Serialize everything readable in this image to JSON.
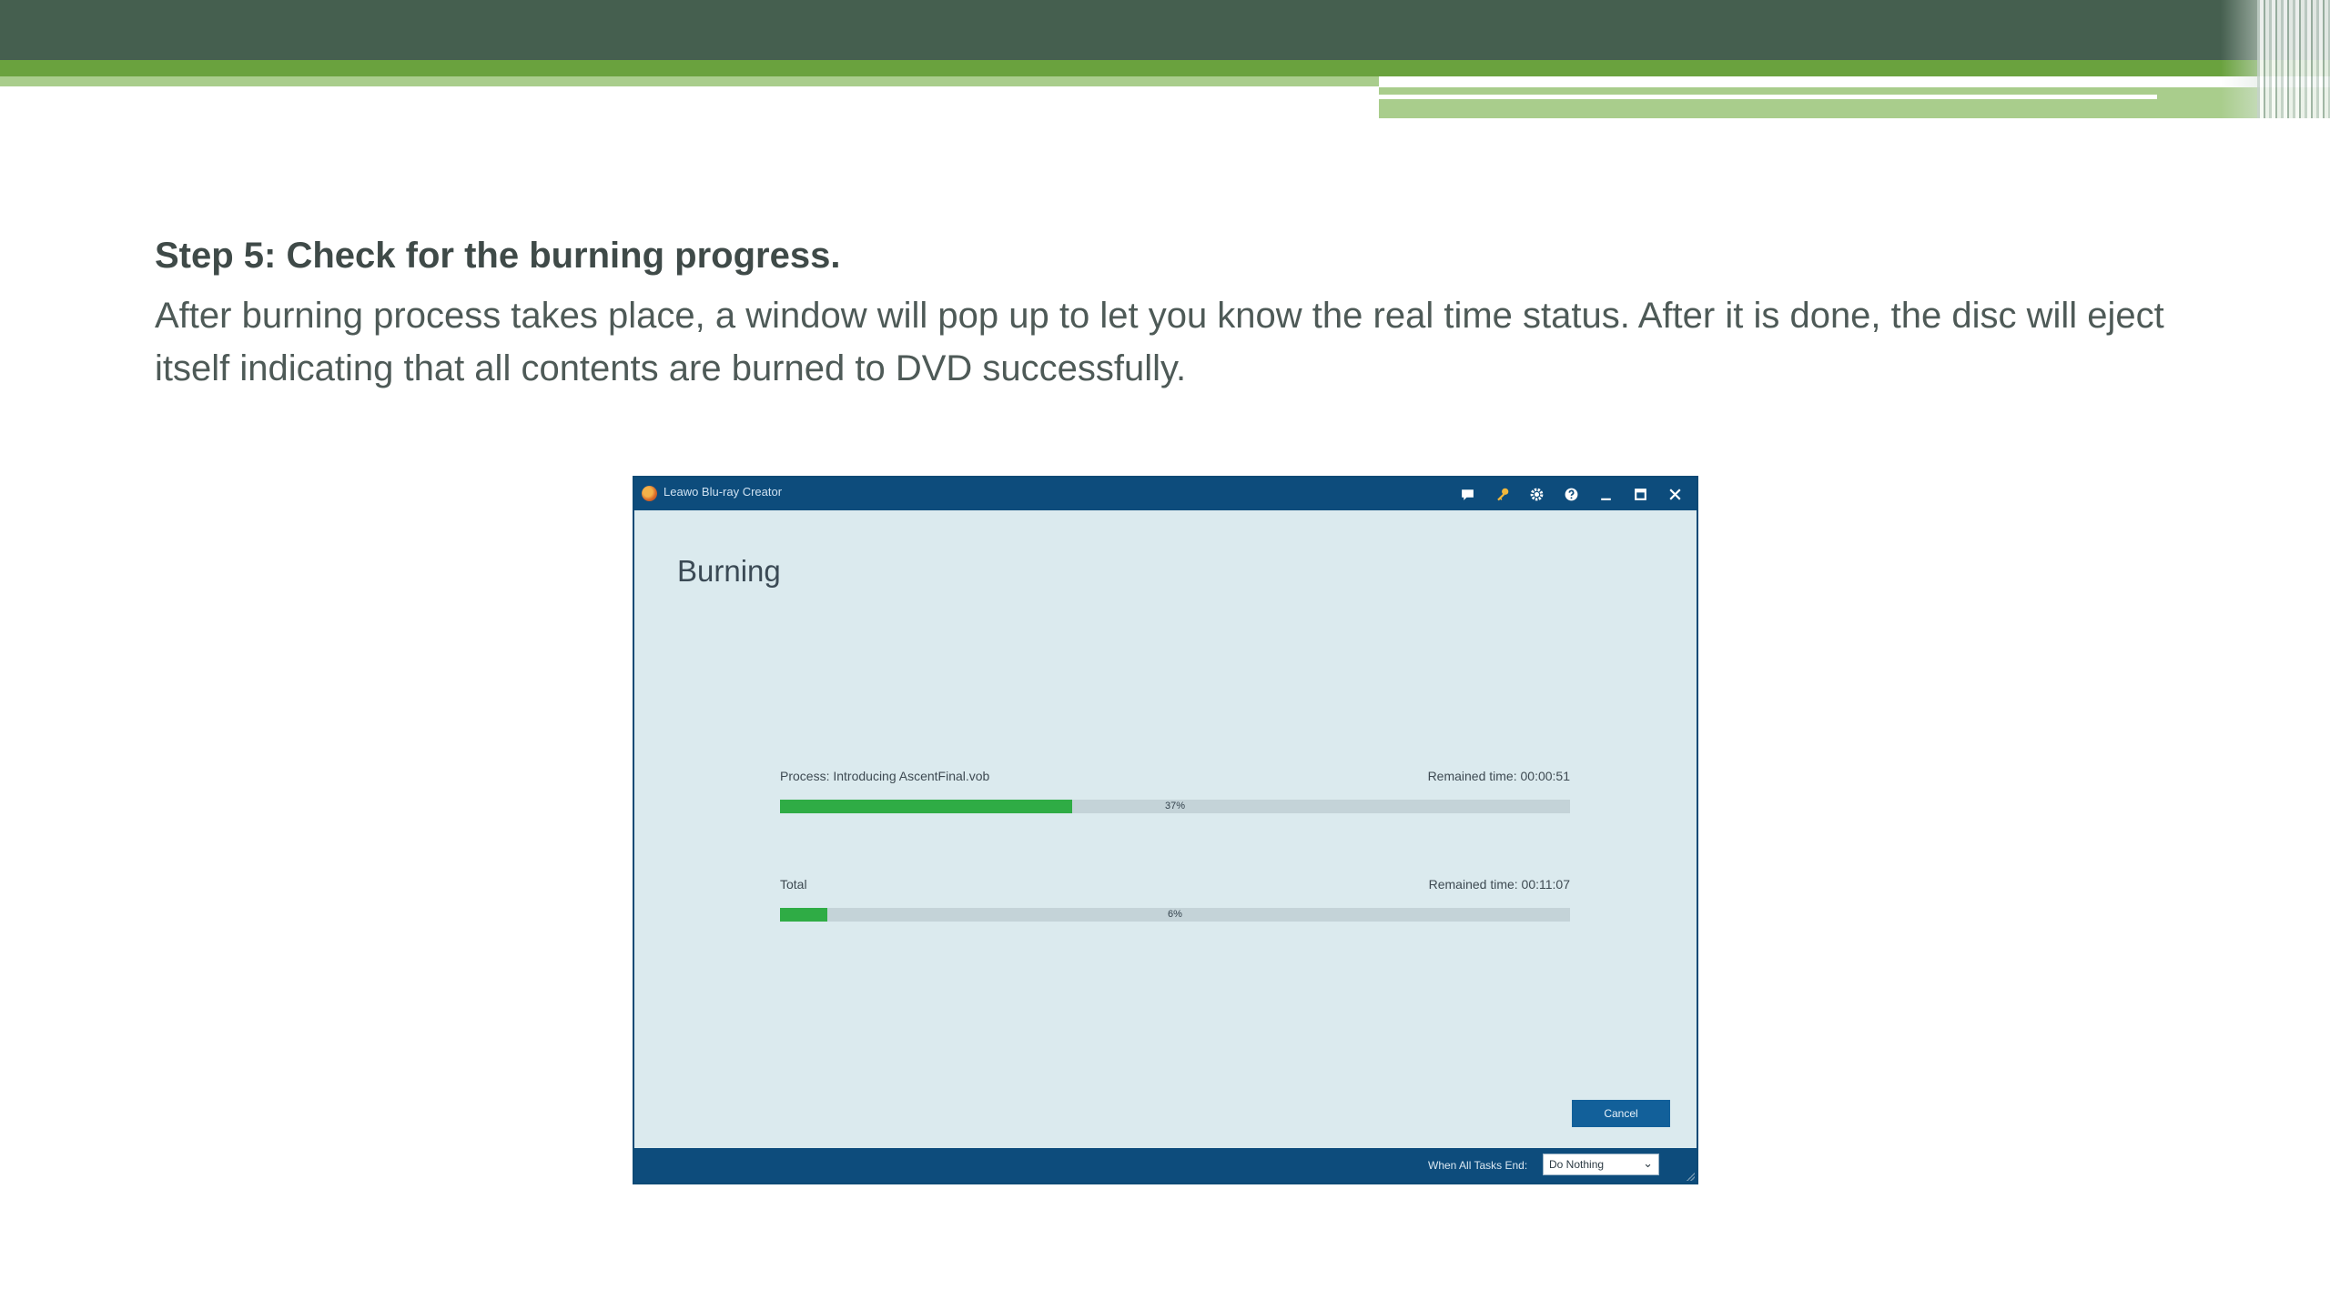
{
  "slide": {
    "step_title": "Step 5: Check for the burning progress.",
    "description": "After burning process takes place, a window will pop up to let you know the real time status. After it is done, the disc will eject itself indicating that all contents are burned to DVD successfully.",
    "colors": {
      "header_dark": "#455f4f",
      "header_green": "#6aa23e",
      "header_light_green": "#a9cd8c",
      "text": "#4e5a57"
    }
  },
  "window": {
    "app_title": "Leawo Blu-ray Creator",
    "titlebar_icons": [
      "chat-icon",
      "key-icon",
      "settings-icon",
      "help-icon",
      "minimize-icon",
      "maximize-icon",
      "close-icon"
    ],
    "page_title": "Burning",
    "progress": {
      "process_label": "Process: Introducing AscentFinal.vob",
      "process_remaining": "Remained time: 00:00:51",
      "process_percent_text": "37%",
      "process_fraction": 0.37,
      "total_label": "Total",
      "total_remaining": "Remained time: 00:11:07",
      "total_percent_text": "6%",
      "total_fraction": 0.06
    },
    "cancel_label": "Cancel",
    "footer": {
      "when_label": "When All Tasks End:",
      "when_value": "Do Nothing"
    },
    "colors": {
      "chrome": "#0d4c7c",
      "content_bg": "#dbeaee",
      "progress_fill": "#2fac45",
      "progress_track": "#c4d3d8",
      "button": "#12609a"
    }
  }
}
